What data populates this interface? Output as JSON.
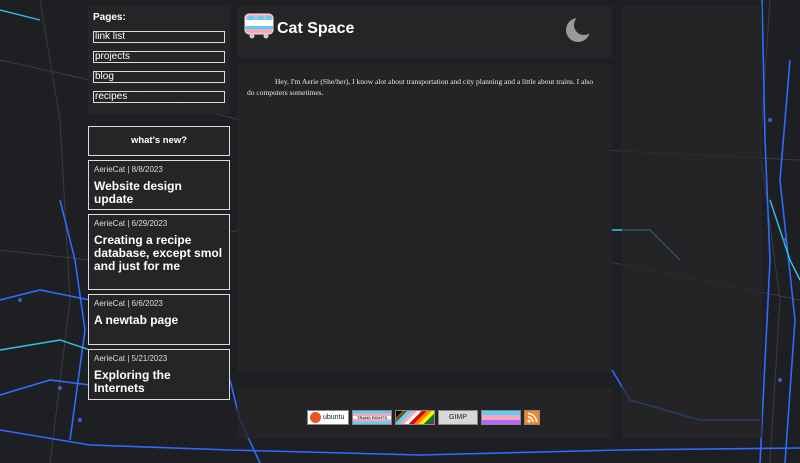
{
  "sidebar": {
    "pages_title": "Pages:",
    "pages": [
      "link list",
      "projects",
      "blog",
      "recipes"
    ],
    "news_heading": "what's new?",
    "posts": [
      {
        "meta": "AerieCat | 8/8/2023",
        "title": "Website design update"
      },
      {
        "meta": "AerieCat | 6/29/2023",
        "title": "Creating a recipe database, except smol and just for me"
      },
      {
        "meta": "AerieCat | 6/6/2023",
        "title": "A newtab page"
      },
      {
        "meta": "AerieCat | 5/21/2023",
        "title": "Exploring the Internets"
      }
    ]
  },
  "header": {
    "site_title": "Cat Space",
    "logo_icon": "train-icon",
    "theme_icon": "moon-icon"
  },
  "main": {
    "intro": "Hey, I'm Aerie (She/her), I know alot about transportation and city planning and a little about trains. I also do computers sometimes."
  },
  "footer": {
    "badges": [
      "ubuntu",
      "TRANS RIGHTS NOW!",
      "",
      "GIMP",
      "",
      ""
    ]
  },
  "colors": {
    "panel": "#262628",
    "rail_blue": "#2f6bff",
    "rail_cyan": "#2fc4e8"
  }
}
